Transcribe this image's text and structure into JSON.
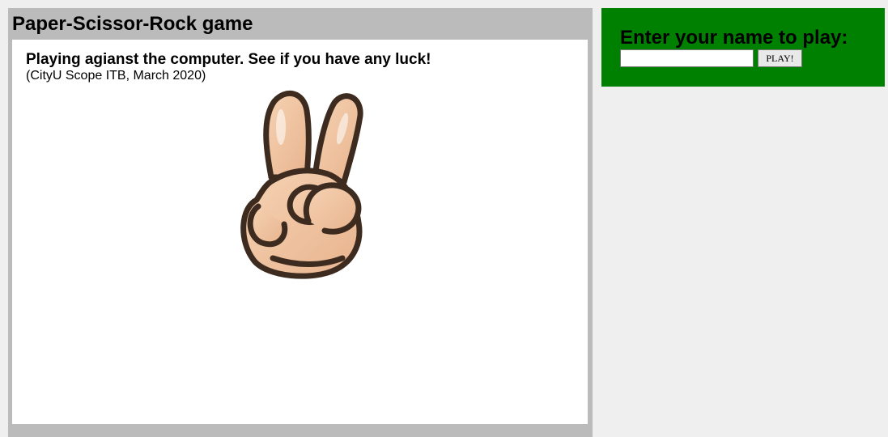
{
  "game": {
    "title": "Paper-Scissor-Rock game",
    "heading": "Playing agianst the computer. See if you have any luck!",
    "credit": "(CityU Scope ITB, March 2020)",
    "hand_icon": "victory-hand-icon"
  },
  "login": {
    "prompt": "Enter your name to play:",
    "name_value": "",
    "name_placeholder": "",
    "play_label": "PLAY!"
  },
  "colors": {
    "page_background": "#efefef",
    "game_frame": "#bbbbbb",
    "login_background": "#008000",
    "skin": "#f1c7a3",
    "skin_shade": "#e6ad85",
    "outline": "#3d2b1f"
  }
}
